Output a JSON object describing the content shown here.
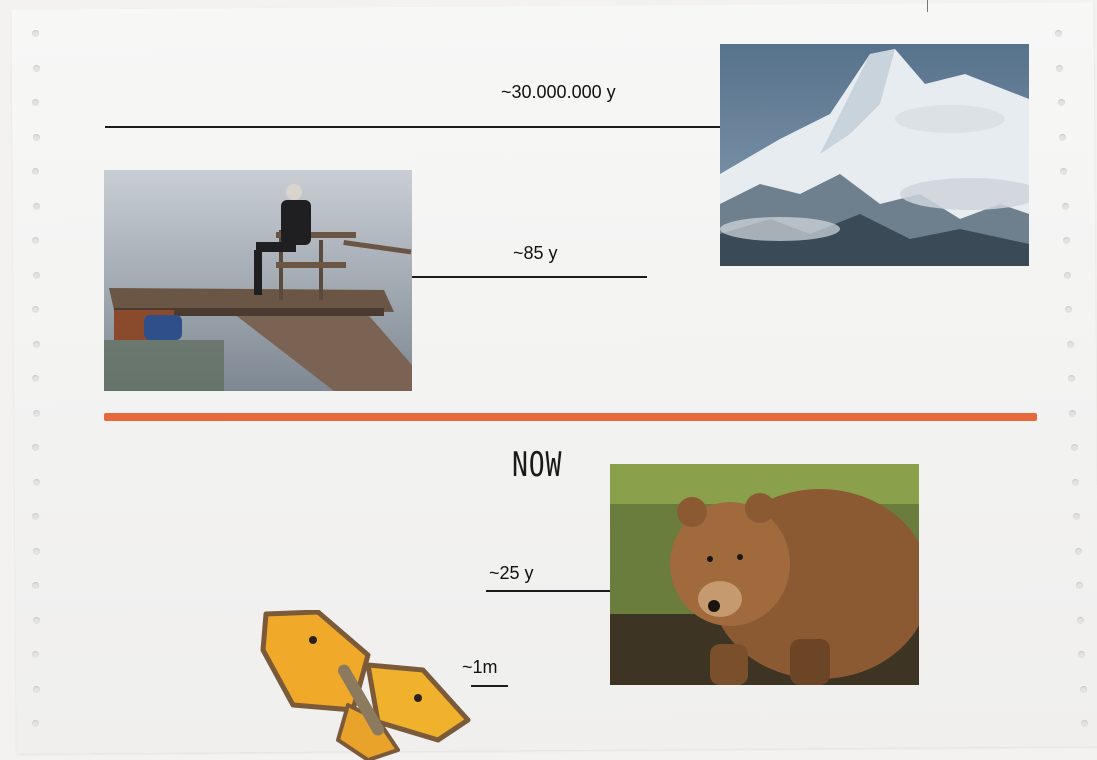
{
  "labels": {
    "mountain_age": "~30.000.000 y",
    "man_age": "~85 y",
    "bear_age": "~25 y",
    "butterfly_age": "~1m",
    "now": "NOW"
  },
  "colors": {
    "divider": "#e8683d",
    "line": "#1c1c1c"
  },
  "images": {
    "mountain": "mountain-photo",
    "man": "old-man-on-dock-photo",
    "bear": "bear-photo",
    "butterfly": "butterfly-image"
  }
}
